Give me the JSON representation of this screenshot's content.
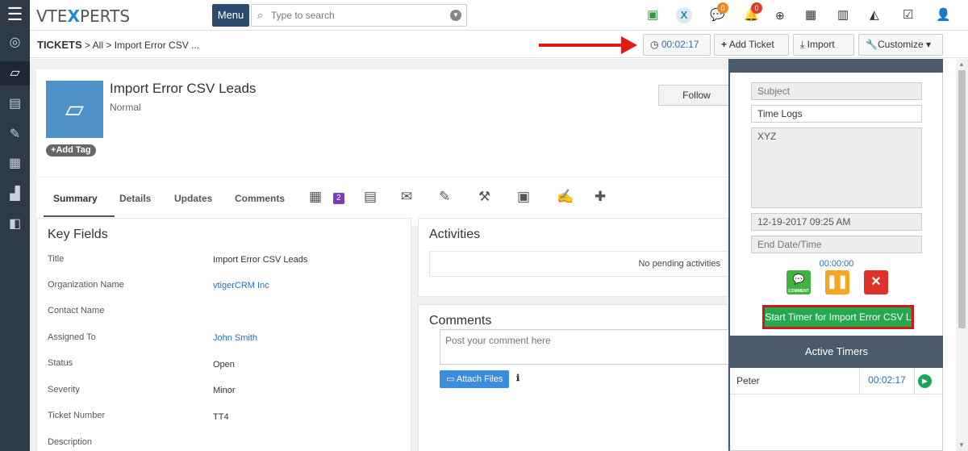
{
  "topbar": {
    "logo_pre": "VTE",
    "logo_x": "X",
    "logo_post": "PERTS",
    "menu_label": "Menu",
    "search_placeholder": "Type to search",
    "chat_badge": "0",
    "notif_badge": "0",
    "badge_color": "#f0861d",
    "notif_badge_color": "#e03b2a"
  },
  "breadcrumb": {
    "root": "TICKETS",
    "sep1": ">",
    "level1": "All",
    "sep2": ">",
    "current": "Import Error CSV ..."
  },
  "header_buttons": {
    "timer": "00:02:17",
    "add_ticket": "Add Ticket",
    "import": "Import",
    "customize": "Customize"
  },
  "record": {
    "title": "Import Error CSV Leads",
    "subtitle": "Normal",
    "add_tag": "Add Tag",
    "follow": "Follow"
  },
  "tabs": {
    "summary": "Summary",
    "details": "Details",
    "updates": "Updates",
    "comments": "Comments",
    "calendar_count": "2"
  },
  "key_fields": {
    "title": "Key Fields",
    "rows": [
      {
        "label": "Title",
        "value": "Import Error CSV Leads"
      },
      {
        "label": "Organization Name",
        "value": "vtigerCRM Inc"
      },
      {
        "label": "Contact Name",
        "value": ""
      },
      {
        "label": "Assigned To",
        "value": "John Smith"
      },
      {
        "label": "Status",
        "value": "Open"
      },
      {
        "label": "Severity",
        "value": "Minor"
      },
      {
        "label": "Ticket Number",
        "value": "TT4"
      },
      {
        "label": "Description",
        "value": ""
      }
    ]
  },
  "activities": {
    "title": "Activities",
    "empty": "No pending activities"
  },
  "comments": {
    "title": "Comments",
    "placeholder": "Post your comment here",
    "attach": "Attach Files"
  },
  "timelog": {
    "subject_placeholder": "Subject",
    "name_value": "Time Logs",
    "description_value": "XYZ",
    "start_value": "12-19-2017 09:25 AM",
    "end_placeholder": "End Date/Time",
    "elapsed": "00:00:00",
    "start_button": "Start Timer for Import Error CSV L",
    "active_title": "Active Timers",
    "active_rows": [
      {
        "name": "Peter",
        "time": "00:02:17"
      }
    ],
    "comment_icon_label": "COMMENT"
  },
  "icons": {
    "hamburger": "hamburger-icon",
    "search": "search-icon",
    "clock": "clock-icon",
    "plus": "plus-icon",
    "download": "download-icon",
    "wrench": "wrench-icon"
  }
}
